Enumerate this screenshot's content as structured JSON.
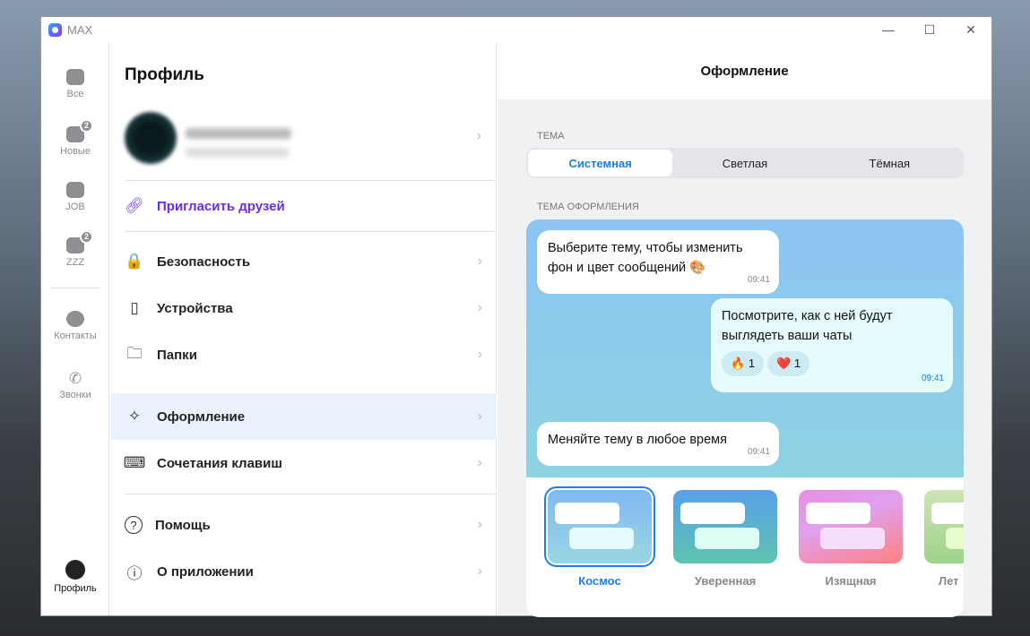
{
  "window": {
    "title": "MAX",
    "minimize": "—",
    "maximize": "☐",
    "close": "✕"
  },
  "rail": [
    {
      "label": "Все"
    },
    {
      "label": "Новые",
      "badge": "2"
    },
    {
      "label": "JOB"
    },
    {
      "label": "ZZZ",
      "badge": "2"
    },
    {
      "label": "Контакты"
    },
    {
      "label": "Звонки"
    },
    {
      "label": "Профиль"
    }
  ],
  "profile": {
    "title": "Профиль",
    "invite": "Пригласить друзей",
    "menu": [
      {
        "label": "Безопасность",
        "icon": "🔒"
      },
      {
        "label": "Устройства",
        "icon": "▯"
      },
      {
        "label": "Папки",
        "icon": "🗀"
      },
      {
        "label": "Оформление",
        "icon": "✧"
      },
      {
        "label": "Сочетания клавиш",
        "icon": "⌨"
      },
      {
        "label": "Помощь",
        "icon": "?"
      },
      {
        "label": "О приложении",
        "icon": "ⓘ"
      }
    ]
  },
  "appearance": {
    "title": "Оформление",
    "theme_label": "Тема",
    "themes": [
      "Системная",
      "Светлая",
      "Тёмная"
    ],
    "selected_theme": "Системная",
    "design_label": "Тема оформления",
    "messages": [
      {
        "text": "Выберите тему, чтобы изменить фон и цвет сообщений 🎨",
        "time": "09:41"
      },
      {
        "text": "Посмотрите, как с ней будут выглядеть ваши чаты",
        "time": "09:41",
        "reactions": [
          {
            "emoji": "🔥",
            "count": "1"
          },
          {
            "emoji": "❤️",
            "count": "1"
          }
        ]
      },
      {
        "text": "Меняйте тему в любое время",
        "time": "09:41"
      }
    ],
    "designs": [
      {
        "name": "Космос",
        "selected": true
      },
      {
        "name": "Уверенная"
      },
      {
        "name": "Изящная"
      },
      {
        "name": "Лет"
      }
    ]
  }
}
